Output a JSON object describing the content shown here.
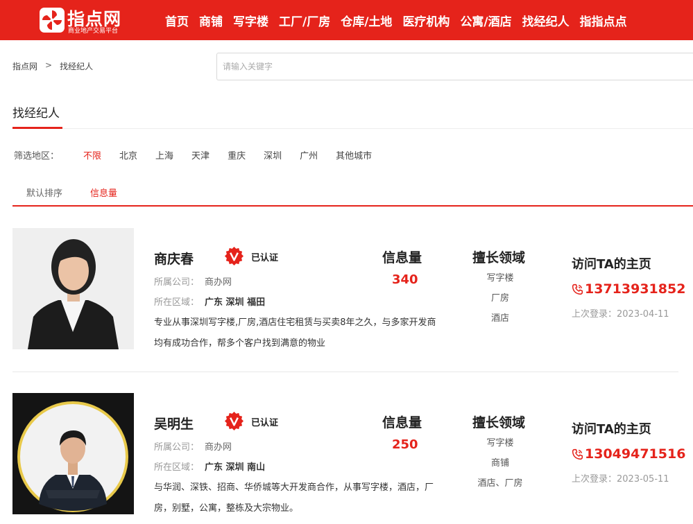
{
  "header": {
    "logo_text": "指点网",
    "logo_subtitle": "商业地产交易平台",
    "nav": [
      "首页",
      "商铺",
      "写字楼",
      "工厂/厂房",
      "仓库/土地",
      "医疗机构",
      "公寓/酒店",
      "找经纪人",
      "指指点点"
    ],
    "brand_color": "#e5231b"
  },
  "breadcrumb": {
    "home": "指点网",
    "separator": ">",
    "current": "找经纪人"
  },
  "search": {
    "placeholder": "请输入关键字"
  },
  "page_title": "找经纪人",
  "filter": {
    "label": "筛选地区：",
    "options": [
      "不限",
      "北京",
      "上海",
      "天津",
      "重庆",
      "深圳",
      "广州",
      "其他城市"
    ],
    "selected": "不限"
  },
  "sort": {
    "options": [
      "默认排序",
      "信息量"
    ],
    "selected": "信息量"
  },
  "agents": [
    {
      "name": "商庆春",
      "verified": "已认证",
      "company_label": "所属公司：",
      "company": "商办网",
      "area_label": "所在区域：",
      "area": "广东 深圳 福田",
      "description": "专业从事深圳写字楼,厂房,酒店住宅租赁与买卖8年之久，与多家开发商均有成功合作，帮多个客户找到满意的物业",
      "stat_label": "信息量",
      "stat_value": "340",
      "spec_label": "擅长领域",
      "specialties": [
        "写字楼",
        "厂房",
        "酒店"
      ],
      "visit_label": "访问TA的主页",
      "phone": "13713931852",
      "last_login": "上次登录：2023-04-11"
    },
    {
      "name": "吴明生",
      "verified": "已认证",
      "company_label": "所属公司：",
      "company": "商办网",
      "area_label": "所在区域：",
      "area": "广东 深圳 南山",
      "description": "与华润、深铁、招商、华侨城等大开发商合作，从事写字楼，酒店，厂房，别墅，公寓，整栋及大宗物业。",
      "stat_label": "信息量",
      "stat_value": "250",
      "spec_label": "擅长领域",
      "specialties": [
        "写字楼",
        "商铺",
        "酒店、厂房"
      ],
      "visit_label": "访问TA的主页",
      "phone": "13049471516",
      "last_login": "上次登录：2023-05-11"
    }
  ]
}
